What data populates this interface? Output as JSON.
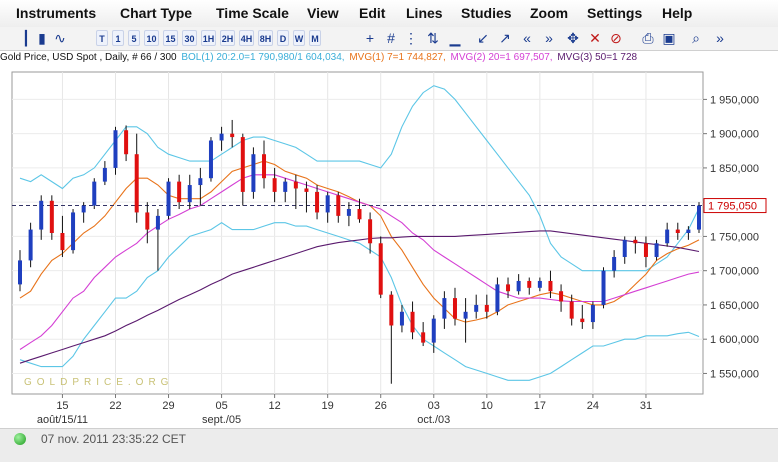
{
  "menu": [
    "Instruments",
    "Chart Type",
    "Time Scale",
    "View",
    "Edit",
    "Lines",
    "Studies",
    "Zoom",
    "Settings",
    "Help"
  ],
  "toolbar": {
    "timescale_buttons": [
      "T",
      "1",
      "5",
      "10",
      "15",
      "30",
      "1H",
      "2H",
      "4H",
      "8H",
      "D",
      "W",
      "M"
    ],
    "icons": [
      "bar-chart-icon",
      "candlestick-icon",
      "line-chart-icon",
      "crosshair-icon",
      "grid-icon",
      "dotted-grid-icon",
      "compare-icon",
      "volume-icon",
      "zoom-out-icon",
      "zoom-in-icon",
      "scroll-left-icon",
      "scroll-right-icon",
      "pan-icon",
      "delete-icon",
      "clear-icon",
      "print-icon",
      "save-icon",
      "magnify-icon",
      "expand-icon"
    ]
  },
  "info": {
    "instrument": "Gold Price, USD Spot , Daily, # 66 / 300",
    "boll": "BOL(1) 20:2.0=1 790,980/1 604,034,",
    "mvg1": "MVG(1) 7=1 744,827,",
    "mvg2": "MVG(2) 20=1 697,507,",
    "mvg3": "MVG(3) 50=1 728"
  },
  "status": {
    "timestamp": "07 nov. 2011 23:35:22 CET"
  },
  "colors": {
    "up": "#1f3fbf",
    "down": "#e01010",
    "bollinger": "#5cc6e6",
    "mvg7": "#e8731a",
    "mvg20": "#d43fd4",
    "mvg50": "#5a1a6e",
    "last_price": "#cc0000"
  },
  "chart_data": {
    "type": "candlestick",
    "ylim": [
      1520,
      1990
    ],
    "yticks": [
      1550,
      1600,
      1650,
      1700,
      1750,
      1800,
      1850,
      1900,
      1950
    ],
    "ytick_labels": [
      "1 550,000",
      "1 600,000",
      "1 650,000",
      "1 700,000",
      "1 750,000",
      "1 800,000",
      "1 850,000",
      "1 900,000",
      "1 950,000"
    ],
    "last_price": 1795.05,
    "last_price_label": "1 795,050",
    "watermark": "GOLDPRICE.ORG",
    "xticks": [
      {
        "i": 4,
        "label": "15",
        "sublabel": "août/15/11"
      },
      {
        "i": 9,
        "label": "22"
      },
      {
        "i": 14,
        "label": "29"
      },
      {
        "i": 19,
        "label": "05",
        "sublabel": "sept./05"
      },
      {
        "i": 24,
        "label": "12"
      },
      {
        "i": 29,
        "label": "19"
      },
      {
        "i": 34,
        "label": "26"
      },
      {
        "i": 39,
        "label": "03",
        "sublabel": "oct./03"
      },
      {
        "i": 44,
        "label": "10"
      },
      {
        "i": 49,
        "label": "17"
      },
      {
        "i": 54,
        "label": "24"
      },
      {
        "i": 59,
        "label": "31"
      }
    ],
    "candles": [
      {
        "o": 1680,
        "h": 1730,
        "l": 1670,
        "c": 1715
      },
      {
        "o": 1715,
        "h": 1770,
        "l": 1705,
        "c": 1760
      },
      {
        "o": 1760,
        "h": 1810,
        "l": 1745,
        "c": 1802
      },
      {
        "o": 1802,
        "h": 1810,
        "l": 1745,
        "c": 1755
      },
      {
        "o": 1755,
        "h": 1780,
        "l": 1720,
        "c": 1730
      },
      {
        "o": 1730,
        "h": 1790,
        "l": 1725,
        "c": 1785
      },
      {
        "o": 1785,
        "h": 1800,
        "l": 1770,
        "c": 1795
      },
      {
        "o": 1795,
        "h": 1835,
        "l": 1790,
        "c": 1830
      },
      {
        "o": 1830,
        "h": 1860,
        "l": 1825,
        "c": 1850
      },
      {
        "o": 1850,
        "h": 1910,
        "l": 1840,
        "c": 1905
      },
      {
        "o": 1905,
        "h": 1912,
        "l": 1860,
        "c": 1870
      },
      {
        "o": 1870,
        "h": 1900,
        "l": 1770,
        "c": 1785
      },
      {
        "o": 1785,
        "h": 1800,
        "l": 1740,
        "c": 1760
      },
      {
        "o": 1760,
        "h": 1790,
        "l": 1700,
        "c": 1780
      },
      {
        "o": 1780,
        "h": 1835,
        "l": 1775,
        "c": 1830
      },
      {
        "o": 1830,
        "h": 1840,
        "l": 1790,
        "c": 1800
      },
      {
        "o": 1800,
        "h": 1840,
        "l": 1790,
        "c": 1825
      },
      {
        "o": 1825,
        "h": 1850,
        "l": 1795,
        "c": 1835
      },
      {
        "o": 1835,
        "h": 1895,
        "l": 1830,
        "c": 1890
      },
      {
        "o": 1890,
        "h": 1910,
        "l": 1875,
        "c": 1900
      },
      {
        "o": 1900,
        "h": 1920,
        "l": 1880,
        "c": 1895
      },
      {
        "o": 1895,
        "h": 1900,
        "l": 1795,
        "c": 1815
      },
      {
        "o": 1815,
        "h": 1880,
        "l": 1805,
        "c": 1870
      },
      {
        "o": 1870,
        "h": 1890,
        "l": 1820,
        "c": 1835
      },
      {
        "o": 1835,
        "h": 1850,
        "l": 1800,
        "c": 1815
      },
      {
        "o": 1815,
        "h": 1835,
        "l": 1800,
        "c": 1830
      },
      {
        "o": 1830,
        "h": 1840,
        "l": 1790,
        "c": 1820
      },
      {
        "o": 1820,
        "h": 1830,
        "l": 1785,
        "c": 1815
      },
      {
        "o": 1815,
        "h": 1825,
        "l": 1775,
        "c": 1785
      },
      {
        "o": 1785,
        "h": 1815,
        "l": 1770,
        "c": 1810
      },
      {
        "o": 1810,
        "h": 1815,
        "l": 1770,
        "c": 1780
      },
      {
        "o": 1780,
        "h": 1800,
        "l": 1765,
        "c": 1790
      },
      {
        "o": 1790,
        "h": 1805,
        "l": 1770,
        "c": 1775
      },
      {
        "o": 1775,
        "h": 1785,
        "l": 1725,
        "c": 1740
      },
      {
        "o": 1740,
        "h": 1750,
        "l": 1660,
        "c": 1665
      },
      {
        "o": 1665,
        "h": 1670,
        "l": 1535,
        "c": 1620
      },
      {
        "o": 1620,
        "h": 1650,
        "l": 1610,
        "c": 1640
      },
      {
        "o": 1640,
        "h": 1655,
        "l": 1600,
        "c": 1610
      },
      {
        "o": 1610,
        "h": 1625,
        "l": 1590,
        "c": 1595
      },
      {
        "o": 1595,
        "h": 1635,
        "l": 1580,
        "c": 1630
      },
      {
        "o": 1630,
        "h": 1670,
        "l": 1615,
        "c": 1660
      },
      {
        "o": 1660,
        "h": 1675,
        "l": 1620,
        "c": 1630
      },
      {
        "o": 1630,
        "h": 1660,
        "l": 1595,
        "c": 1640
      },
      {
        "o": 1640,
        "h": 1665,
        "l": 1630,
        "c": 1650
      },
      {
        "o": 1650,
        "h": 1665,
        "l": 1630,
        "c": 1640
      },
      {
        "o": 1640,
        "h": 1690,
        "l": 1635,
        "c": 1680
      },
      {
        "o": 1680,
        "h": 1690,
        "l": 1660,
        "c": 1670
      },
      {
        "o": 1670,
        "h": 1695,
        "l": 1665,
        "c": 1685
      },
      {
        "o": 1685,
        "h": 1690,
        "l": 1665,
        "c": 1675
      },
      {
        "o": 1675,
        "h": 1690,
        "l": 1670,
        "c": 1685
      },
      {
        "o": 1685,
        "h": 1700,
        "l": 1660,
        "c": 1670
      },
      {
        "o": 1670,
        "h": 1680,
        "l": 1640,
        "c": 1655
      },
      {
        "o": 1655,
        "h": 1665,
        "l": 1620,
        "c": 1630
      },
      {
        "o": 1630,
        "h": 1650,
        "l": 1615,
        "c": 1625
      },
      {
        "o": 1625,
        "h": 1655,
        "l": 1615,
        "c": 1650
      },
      {
        "o": 1650,
        "h": 1705,
        "l": 1645,
        "c": 1700
      },
      {
        "o": 1700,
        "h": 1730,
        "l": 1690,
        "c": 1720
      },
      {
        "o": 1720,
        "h": 1750,
        "l": 1710,
        "c": 1745
      },
      {
        "o": 1745,
        "h": 1750,
        "l": 1725,
        "c": 1740
      },
      {
        "o": 1740,
        "h": 1750,
        "l": 1705,
        "c": 1720
      },
      {
        "o": 1720,
        "h": 1745,
        "l": 1715,
        "c": 1740
      },
      {
        "o": 1740,
        "h": 1770,
        "l": 1735,
        "c": 1760
      },
      {
        "o": 1760,
        "h": 1770,
        "l": 1745,
        "c": 1755
      },
      {
        "o": 1755,
        "h": 1765,
        "l": 1745,
        "c": 1760
      },
      {
        "o": 1760,
        "h": 1800,
        "l": 1755,
        "c": 1795
      }
    ],
    "series": [
      {
        "name": "BOL(1) 20:2.0",
        "color": "#5cc6e6",
        "values": [
          1570,
          1565,
          1560,
          1560,
          1560,
          1575,
          1600,
          1620,
          1640,
          1660,
          1660,
          1670,
          1690,
          1700,
          1720,
          1735,
          1750,
          1755,
          1760,
          1770,
          1760,
          1760,
          1760,
          1765,
          1770,
          1770,
          1765,
          1765,
          1760,
          1755,
          1750,
          1745,
          1740,
          1730,
          1720,
          1690,
          1650,
          1620,
          1600,
          1590,
          1580,
          1570,
          1560,
          1555,
          1550,
          1545,
          1540,
          1540,
          1540,
          1545,
          1550,
          1560,
          1570,
          1580,
          1590,
          1590,
          1595,
          1600,
          1600,
          1605,
          1605,
          1605,
          1608,
          1610,
          1604
        ]
      },
      {
        "name": "BOL(1) 20:2.0",
        "color": "#5cc6e6",
        "values": [
          1835,
          1830,
          1840,
          1830,
          1820,
          1835,
          1840,
          1850,
          1870,
          1890,
          1910,
          1910,
          1900,
          1880,
          1870,
          1865,
          1860,
          1860,
          1860,
          1870,
          1880,
          1890,
          1895,
          1895,
          1890,
          1885,
          1880,
          1870,
          1860,
          1860,
          1860,
          1860,
          1860,
          1855,
          1850,
          1870,
          1910,
          1940,
          1960,
          1970,
          1965,
          1950,
          1930,
          1910,
          1890,
          1870,
          1850,
          1830,
          1810,
          1780,
          1740,
          1720,
          1710,
          1700,
          1700,
          1700,
          1700,
          1700,
          1700,
          1700,
          1710,
          1720,
          1740,
          1760,
          1791
        ]
      },
      {
        "name": "MVG(1) 7",
        "color": "#e8731a",
        "values": [
          1660,
          1670,
          1695,
          1715,
          1725,
          1740,
          1755,
          1765,
          1780,
          1800,
          1820,
          1835,
          1835,
          1825,
          1810,
          1805,
          1805,
          1805,
          1815,
          1830,
          1845,
          1850,
          1855,
          1860,
          1855,
          1845,
          1840,
          1835,
          1825,
          1820,
          1815,
          1808,
          1800,
          1795,
          1780,
          1750,
          1730,
          1705,
          1680,
          1660,
          1645,
          1630,
          1625,
          1628,
          1632,
          1640,
          1650,
          1655,
          1660,
          1665,
          1668,
          1665,
          1660,
          1655,
          1650,
          1650,
          1655,
          1665,
          1680,
          1695,
          1715,
          1725,
          1732,
          1737,
          1745
        ]
      },
      {
        "name": "MVG(2) 20",
        "color": "#d43fd4",
        "values": [
          1585,
          1595,
          1605,
          1620,
          1640,
          1660,
          1670,
          1690,
          1705,
          1720,
          1730,
          1740,
          1755,
          1765,
          1775,
          1782,
          1790,
          1795,
          1805,
          1815,
          1825,
          1835,
          1840,
          1840,
          1840,
          1835,
          1830,
          1825,
          1820,
          1815,
          1810,
          1805,
          1800,
          1795,
          1790,
          1780,
          1770,
          1755,
          1745,
          1730,
          1720,
          1710,
          1700,
          1690,
          1680,
          1670,
          1665,
          1660,
          1660,
          1660,
          1658,
          1656,
          1655,
          1655,
          1655,
          1655,
          1660,
          1665,
          1670,
          1675,
          1680,
          1685,
          1690,
          1695,
          1698
        ]
      },
      {
        "name": "MVG(3) 50",
        "color": "#5a1a6e",
        "values": [
          1565,
          1570,
          1575,
          1580,
          1585,
          1590,
          1595,
          1600,
          1605,
          1612,
          1620,
          1627,
          1635,
          1642,
          1650,
          1658,
          1665,
          1672,
          1680,
          1687,
          1695,
          1700,
          1705,
          1710,
          1715,
          1720,
          1725,
          1730,
          1735,
          1738,
          1741,
          1743,
          1745,
          1747,
          1748,
          1748,
          1749,
          1750,
          1750,
          1750,
          1750,
          1750,
          1751,
          1752,
          1753,
          1754,
          1755,
          1756,
          1757,
          1758,
          1758,
          1756,
          1754,
          1752,
          1750,
          1748,
          1746,
          1744,
          1742,
          1740,
          1738,
          1736,
          1734,
          1731,
          1728
        ]
      }
    ]
  }
}
